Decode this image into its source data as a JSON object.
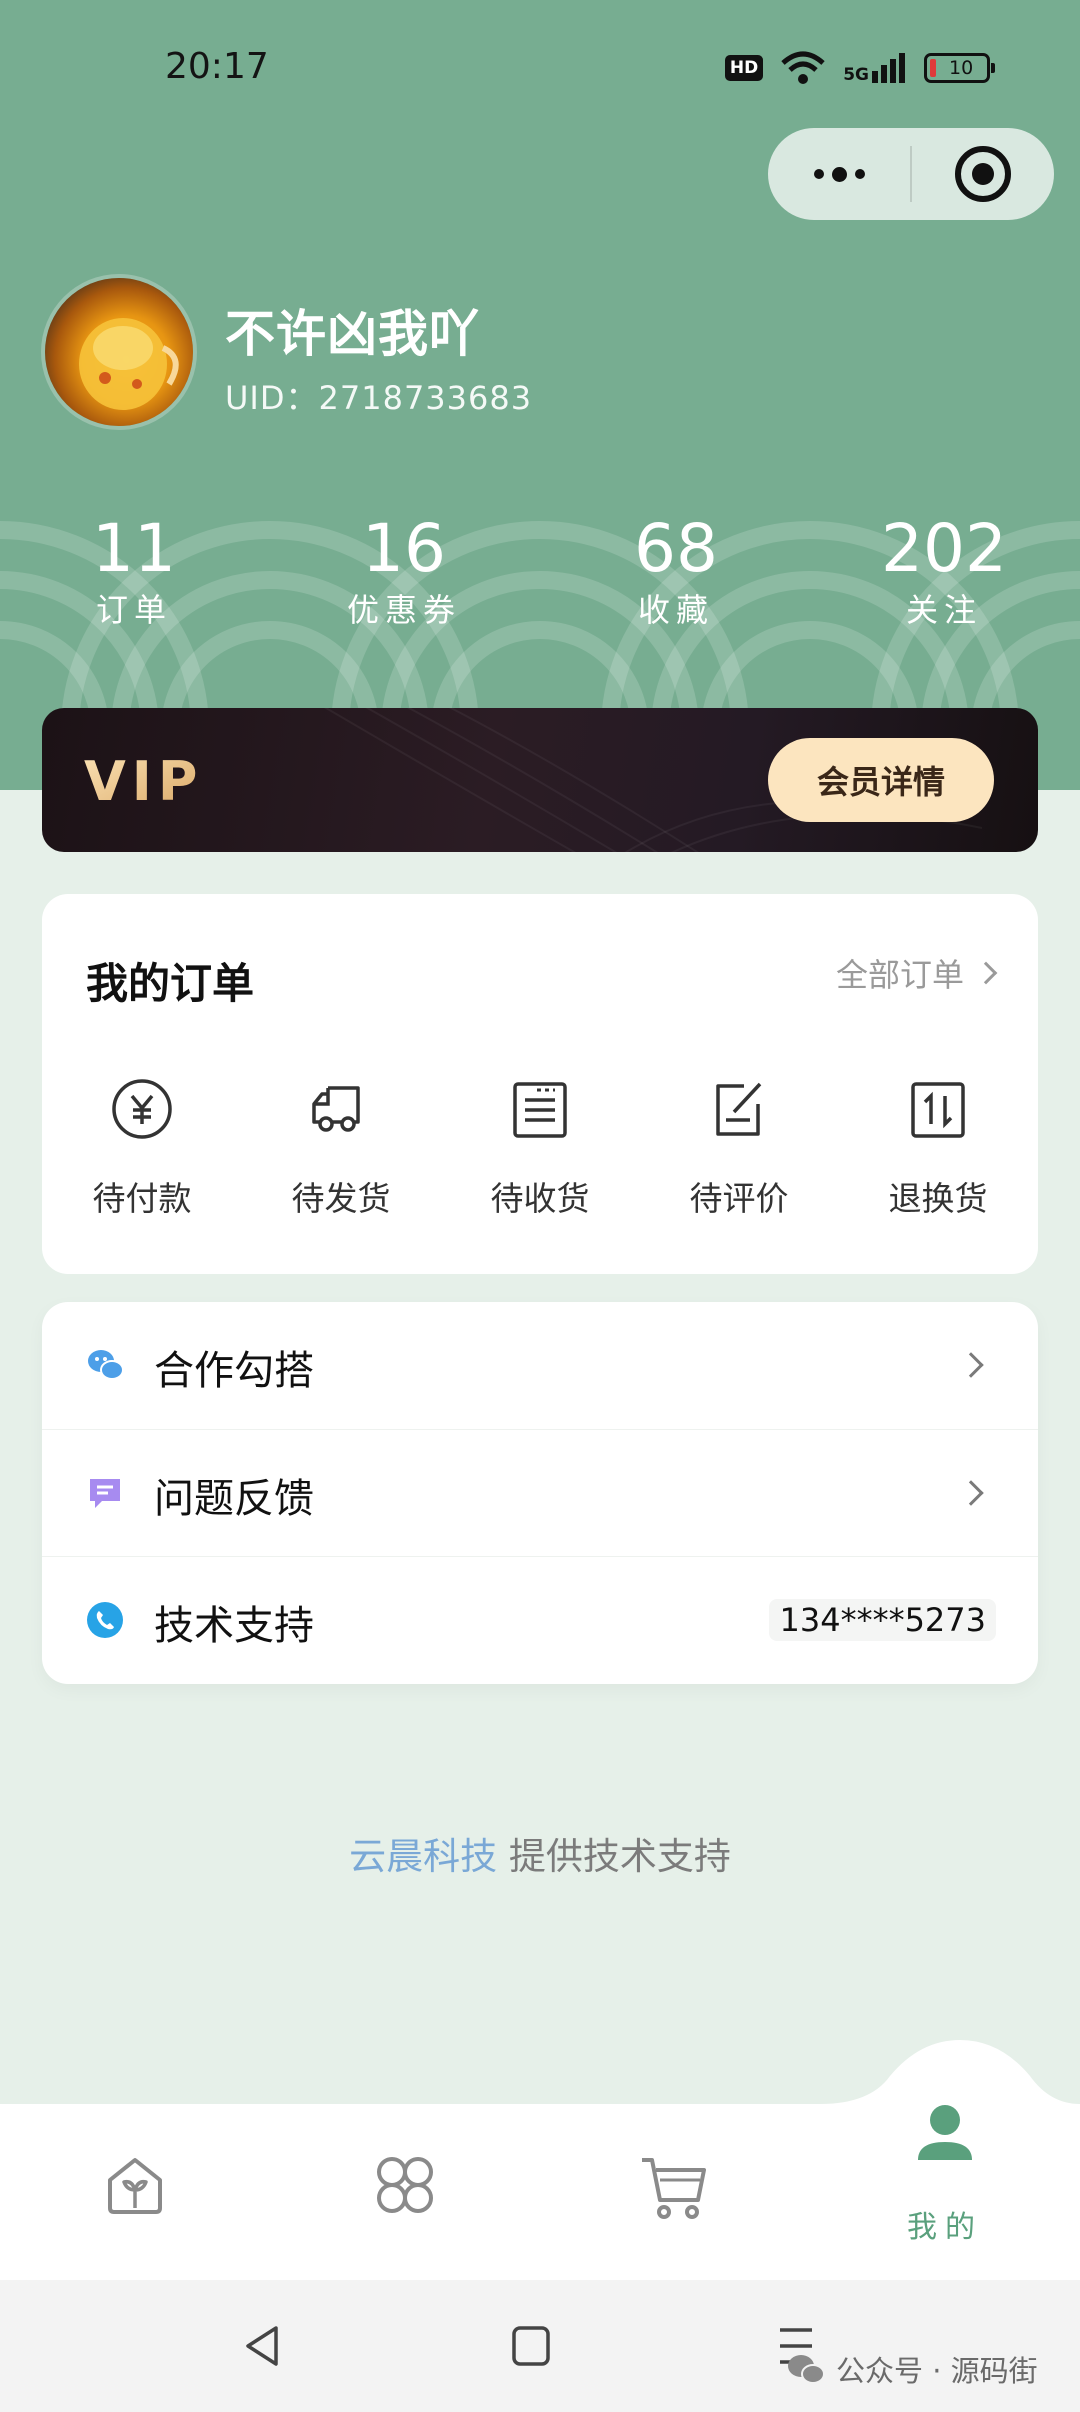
{
  "status_bar": {
    "time": "20:17",
    "hd": "HD",
    "network": "5G",
    "battery": "10"
  },
  "profile": {
    "username": "不许凶我吖",
    "uid": "UID：2718733683"
  },
  "stats": [
    {
      "value": "11",
      "label": "订单"
    },
    {
      "value": "16",
      "label": "优惠券"
    },
    {
      "value": "68",
      "label": "收藏"
    },
    {
      "value": "202",
      "label": "关注"
    }
  ],
  "vip": {
    "logo_text": "VIP",
    "button_label": "会员详情"
  },
  "orders": {
    "title": "我的订单",
    "all_label": "全部订单",
    "items": [
      {
        "label": "待付款",
        "icon": "yen-circle-icon"
      },
      {
        "label": "待发货",
        "icon": "truck-icon"
      },
      {
        "label": "待收货",
        "icon": "receipt-icon"
      },
      {
        "label": "待评价",
        "icon": "edit-note-icon"
      },
      {
        "label": "退换货",
        "icon": "exchange-icon"
      }
    ]
  },
  "menu": [
    {
      "label": "合作勾搭",
      "icon": "wechat-icon",
      "color": "#4d9fe8"
    },
    {
      "label": "问题反馈",
      "icon": "feedback-icon",
      "color": "#a78bf0"
    },
    {
      "label": "技术支持",
      "icon": "phone-icon",
      "color": "#27a3e6",
      "value": "134****5273"
    }
  ],
  "credit": {
    "brand": "云晨科技",
    "text": " 提供技术支持"
  },
  "tabbar": {
    "items": [
      {
        "icon": "home-icon"
      },
      {
        "icon": "category-icon"
      },
      {
        "icon": "cart-icon"
      },
      {
        "icon": "user-icon",
        "label": "我的",
        "active": true
      }
    ],
    "active_color": "#5aa07d"
  },
  "watermark": "公众号 · 源码街",
  "colors": {
    "header": "#77ad91",
    "page": "#e6f0e9",
    "vip_button": "#fce5bf"
  }
}
